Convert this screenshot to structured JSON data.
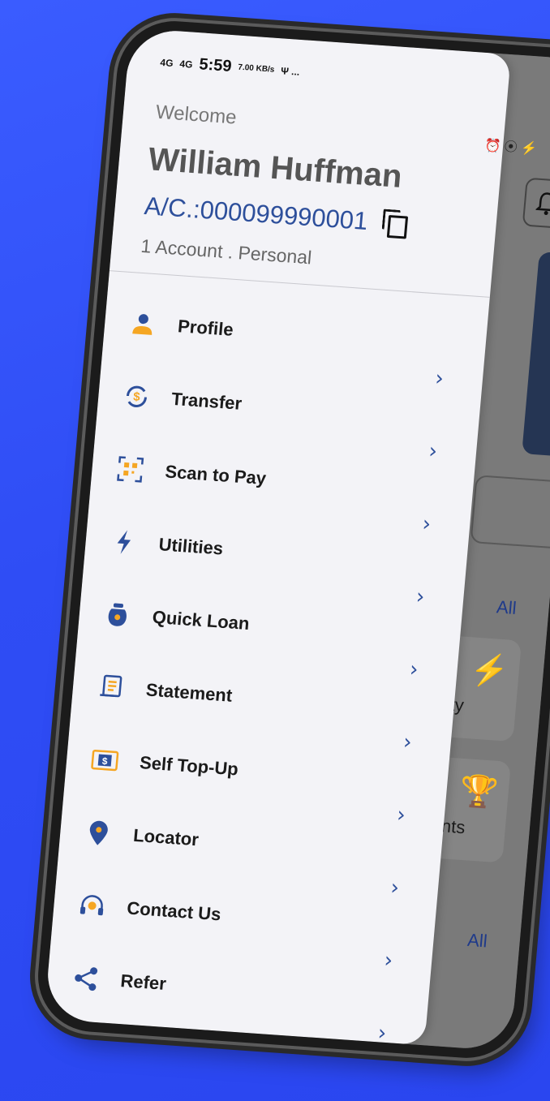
{
  "status_bar": {
    "signal_1": "4G",
    "signal_2": "4G",
    "time": "5:59",
    "speed": "7.00 KB/s",
    "extra": "Ψ ...",
    "right_icons": "⏰ ⦿ ⚡"
  },
  "drawer": {
    "welcome": "Welcome",
    "user_name": "William Huffman",
    "account_number": "A/C.:000099990001",
    "account_type": "1 Account . Personal"
  },
  "menu": [
    {
      "label": "Profile",
      "icon": "profile-icon",
      "color": "#f5a623"
    },
    {
      "label": "Transfer",
      "icon": "transfer-icon",
      "color": "#f5a623"
    },
    {
      "label": "Scan to Pay",
      "icon": "qr-scan-icon",
      "color": "#f5a623"
    },
    {
      "label": "Utilities",
      "icon": "lightning-icon",
      "color": "#2d4f9b"
    },
    {
      "label": "Quick Loan",
      "icon": "money-bag-icon",
      "color": "#2d4f9b"
    },
    {
      "label": "Statement",
      "icon": "receipt-icon",
      "color": "#2d4f9b"
    },
    {
      "label": "Self Top-Up",
      "icon": "dollar-card-icon",
      "color": "#f5a623"
    },
    {
      "label": "Locator",
      "icon": "location-pin-icon",
      "color": "#2d4f9b"
    },
    {
      "label": "Contact Us",
      "icon": "headset-icon",
      "color": "#f5a623"
    },
    {
      "label": "Refer",
      "icon": "share-icon",
      "color": "#2d4f9b"
    }
  ],
  "background": {
    "view_all_1": "All",
    "view_all_2": "All",
    "tile_1_label": "tility",
    "tile_2_label": "vents"
  },
  "colors": {
    "background": "#2f4df5",
    "accent_blue": "#2d4f9b",
    "accent_orange": "#f5a623"
  }
}
